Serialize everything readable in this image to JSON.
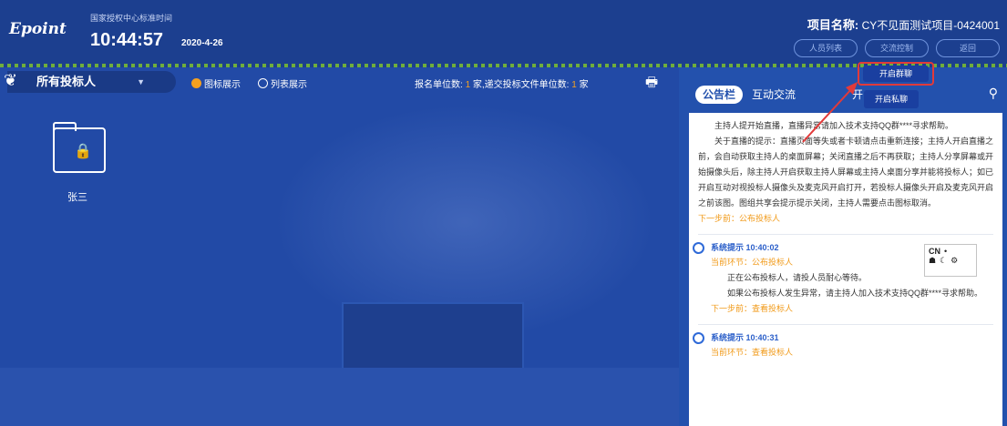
{
  "header": {
    "logo": "Epoint",
    "time_caption": "国家授权中心标准时间",
    "clock": "10:44:57",
    "date": "2020-4-26",
    "project_label": "项目名称:",
    "project_name": "CY不见面测试项目-0424001",
    "buttons": [
      "人员列表",
      "交流控制",
      "返回"
    ]
  },
  "toolbar": {
    "selector_label": "所有投标人",
    "view_icon": "图标展示",
    "view_list": "列表展示",
    "stats_prefix": "报名单位数:",
    "stats_signup": "1",
    "stats_mid": "家,递交投标文件单位数:",
    "stats_submitted": "1",
    "stats_suffix": "家"
  },
  "folder": {
    "name": "张三"
  },
  "panel": {
    "tabs": [
      "公告栏",
      "互动交流",
      "开"
    ],
    "announcement_lines": [
      "主持人提开始直播，直播异常请加入技术支持QQ群****寻求帮助。",
      "关于直播的提示：直播页面等失或者卡顿请点击重新连接；主持人开启直播之前，会自动获取主持人的桌面屏幕；关闭直播之后不再获取；主持人分享屏幕或开始摄像头后，除主持人开启获取主持人屏幕或主持人桌面分享并能将投标人；如已开启互动对视投标人摄像头及麦克风开启打开，若投标人摄像头开启及麦克风开启之前该图。图组共享会提示提示关闭，主持人需要点击图标取消。"
    ],
    "next_step_1": "下一步前：公布投标人",
    "sys1_title": "系统提示 10:40:02",
    "sys1_stage": "当前环节：公布投标人",
    "sys1_body": [
      "正在公布投标人，请投人员耐心等待。",
      "如果公布投标人发生异常，请主持人加入技术支持QQ群****寻求帮助。"
    ],
    "next_step_2": "下一步前：查看投标人",
    "sys2_title": "系统提示 10:40:31",
    "sys2_stage": "当前环节：查看投标人"
  },
  "popup": {
    "btn_open_chat": "开启群聊",
    "btn_open_private": "开启私聊"
  },
  "ime": {
    "lang": "CN"
  },
  "colors": {
    "header": "#1c3f8f",
    "main": "#224aa6",
    "panel": "#2351ad",
    "accent": "#f4a020",
    "highlight": "#e23a3a"
  }
}
